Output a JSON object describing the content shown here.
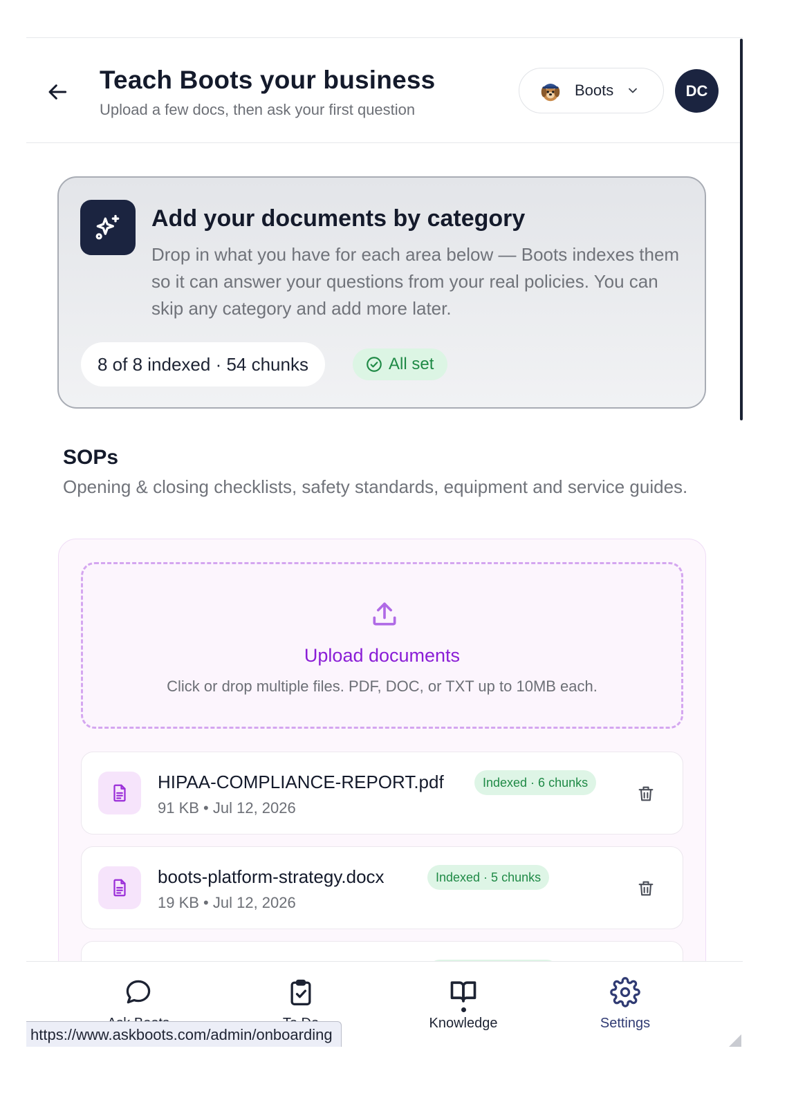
{
  "header": {
    "title": "Teach Boots your business",
    "subtitle": "Upload a few docs, then ask your first question",
    "agent_label": "Boots",
    "avatar_initials": "DC"
  },
  "intro": {
    "title": "Add your documents by category",
    "description": "Drop in what you have for each area below — Boots indexes them so it can answer your questions from your real policies. You can skip any category and add more later.",
    "count_text": "8 of 8 indexed · 54 chunks",
    "status_text": "All set"
  },
  "section": {
    "title": "SOPs",
    "description": "Opening & closing checklists, safety standards, equipment and service guides.",
    "upload_title": "Upload documents",
    "upload_hint": "Click or drop multiple files. PDF, DOC, or TXT up to 10MB each.",
    "files": [
      {
        "name": "HIPAA-COMPLIANCE-REPORT.pdf",
        "meta": "91 KB • Jul 12, 2026",
        "badge": "Indexed · 6 chunks"
      },
      {
        "name": "boots-platform-strategy.docx",
        "meta": "19 KB • Jul 12, 2026",
        "badge": "Indexed · 5 chunks"
      },
      {
        "name": "",
        "meta": "",
        "badge": ""
      }
    ]
  },
  "bottom_nav": {
    "items": [
      {
        "label": "Ask Boots",
        "icon": "chat-bubble-icon"
      },
      {
        "label": "To Do",
        "icon": "clipboard-check-icon"
      },
      {
        "label": "Knowledge",
        "icon": "open-book-icon",
        "active": true
      },
      {
        "label": "Settings",
        "icon": "gear-icon"
      }
    ]
  },
  "status_url": "https://www.askboots.com/admin/onboarding",
  "colors": {
    "navy": "#1b2440",
    "purple_accent": "#8a1ed6",
    "success_green": "#1f8a46",
    "success_bg": "#dcf5e4"
  }
}
